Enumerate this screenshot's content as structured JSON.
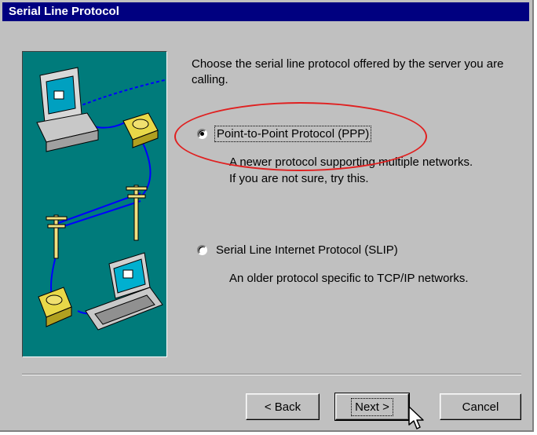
{
  "window": {
    "title": "Serial Line Protocol"
  },
  "intro_text": "Choose the serial line protocol offered by the server you are calling.",
  "options": [
    {
      "label": "Point-to-Point Protocol (PPP)",
      "description_line1": "A newer protocol supporting multiple networks.",
      "description_line2": "If you are not sure, try this.",
      "selected": true
    },
    {
      "label": "Serial Line Internet Protocol (SLIP)",
      "description_line1": "An older protocol specific to TCP/IP networks.",
      "selected": false
    }
  ],
  "buttons": {
    "back": "< Back",
    "next": "Next >",
    "cancel": "Cancel"
  },
  "colors": {
    "titlebar": "#000080",
    "dialog": "#c0c0c0",
    "illustration_bg": "#007b7b",
    "annotation": "#e02020"
  },
  "icons": [
    "desktop-computer-icon",
    "telephone-icon",
    "telephone-pole-icon",
    "laptop-icon",
    "mouse-pointer-icon"
  ]
}
